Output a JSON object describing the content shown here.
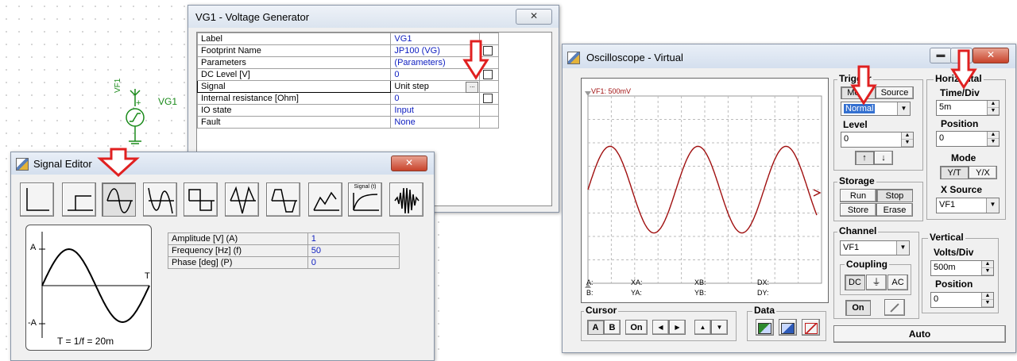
{
  "canvas": {
    "component_label": "VG1",
    "component_pin_label": "VF1",
    "plus_sign": "+"
  },
  "voltage_generator": {
    "title": "VG1 - Voltage Generator",
    "close_label": "✕",
    "rows": [
      {
        "label": "Label",
        "value": "VG1"
      },
      {
        "label": "Footprint Name",
        "value": "JP100 (VG)"
      },
      {
        "label": "Parameters",
        "value": "(Parameters)"
      },
      {
        "label": "DC Level [V]",
        "value": "0"
      },
      {
        "label": "Signal",
        "value": "Unit step"
      },
      {
        "label": "Internal resistance [Ohm]",
        "value": "0"
      },
      {
        "label": "IO state",
        "value": "Input"
      },
      {
        "label": "Fault",
        "value": "None"
      }
    ],
    "ellipsis_label": "..."
  },
  "signal_editor": {
    "title": "Signal Editor",
    "close_label": "✕",
    "tools": [
      {
        "name": "unit-impulse"
      },
      {
        "name": "unit-step"
      },
      {
        "name": "sine-wave"
      },
      {
        "name": "cosine-wave"
      },
      {
        "name": "square-wave"
      },
      {
        "name": "triangle-wave"
      },
      {
        "name": "trapezoidal-wave"
      },
      {
        "name": "piecewise-linear"
      },
      {
        "name": "general-signal",
        "label": "Signal (t)"
      },
      {
        "name": "sweep"
      }
    ],
    "params": [
      {
        "label": "Amplitude [V] (A)",
        "value": "1"
      },
      {
        "label": "Frequency [Hz] (f)",
        "value": "50"
      },
      {
        "label": "Phase [deg] (P)",
        "value": "0"
      }
    ],
    "preview": {
      "amp_pos_label": "A",
      "amp_neg_label": "-A",
      "period_end_label": "T",
      "formula": "T = 1/f = 20m"
    }
  },
  "oscilloscope": {
    "title": "Oscilloscope - Virtual",
    "min_label": "▬",
    "max_label": "▭",
    "close_label": "✕",
    "screen": {
      "channel_label": "VF1: 500mV",
      "readouts": [
        {
          "key": "A:",
          "value": ""
        },
        {
          "key": "XA:",
          "value": ""
        },
        {
          "key": "XB:",
          "value": ""
        },
        {
          "key": "DX:",
          "value": ""
        },
        {
          "key": "B:",
          "value": ""
        },
        {
          "key": "YA:",
          "value": ""
        },
        {
          "key": "YB:",
          "value": ""
        },
        {
          "key": "DY:",
          "value": ""
        }
      ]
    },
    "trigger": {
      "group_label": "Trigger",
      "mode_label": "Mode",
      "source_label": "Source",
      "mode_value": "Normal",
      "level_label": "Level",
      "level_value": "0",
      "slope_rise": "↑",
      "slope_fall": "↓"
    },
    "storage": {
      "group_label": "Storage",
      "run": "Run",
      "stop": "Stop",
      "store": "Store",
      "erase": "Erase"
    },
    "horizontal": {
      "group_label": "Horizontal",
      "time_div_label": "Time/Div",
      "time_div_value": "5m",
      "position_label": "Position",
      "position_value": "0",
      "mode_label": "Mode",
      "mode_yt": "Y/T",
      "mode_yx": "Y/X",
      "x_source_label": "X Source",
      "x_source_value": "VF1"
    },
    "channel": {
      "group_label": "Channel",
      "channel_value": "VF1",
      "coupling_label": "Coupling",
      "dc": "DC",
      "gnd": "⏚",
      "ac": "AC",
      "on": "On"
    },
    "vertical": {
      "group_label": "Vertical",
      "volts_div_label": "Volts/Div",
      "volts_div_value": "500m",
      "position_label": "Position",
      "position_value": "0"
    },
    "cursor": {
      "group_label": "Cursor",
      "a": "A",
      "b": "B",
      "on": "On",
      "left": "◀",
      "right": "▶",
      "up": "▲",
      "down": "▼"
    },
    "data": {
      "group_label": "Data"
    },
    "auto_label": "Auto"
  },
  "colors": {
    "trace": "#a01010",
    "arrow": "#e02020",
    "value_text": "#1020c0",
    "component": "#1a8a1a"
  }
}
